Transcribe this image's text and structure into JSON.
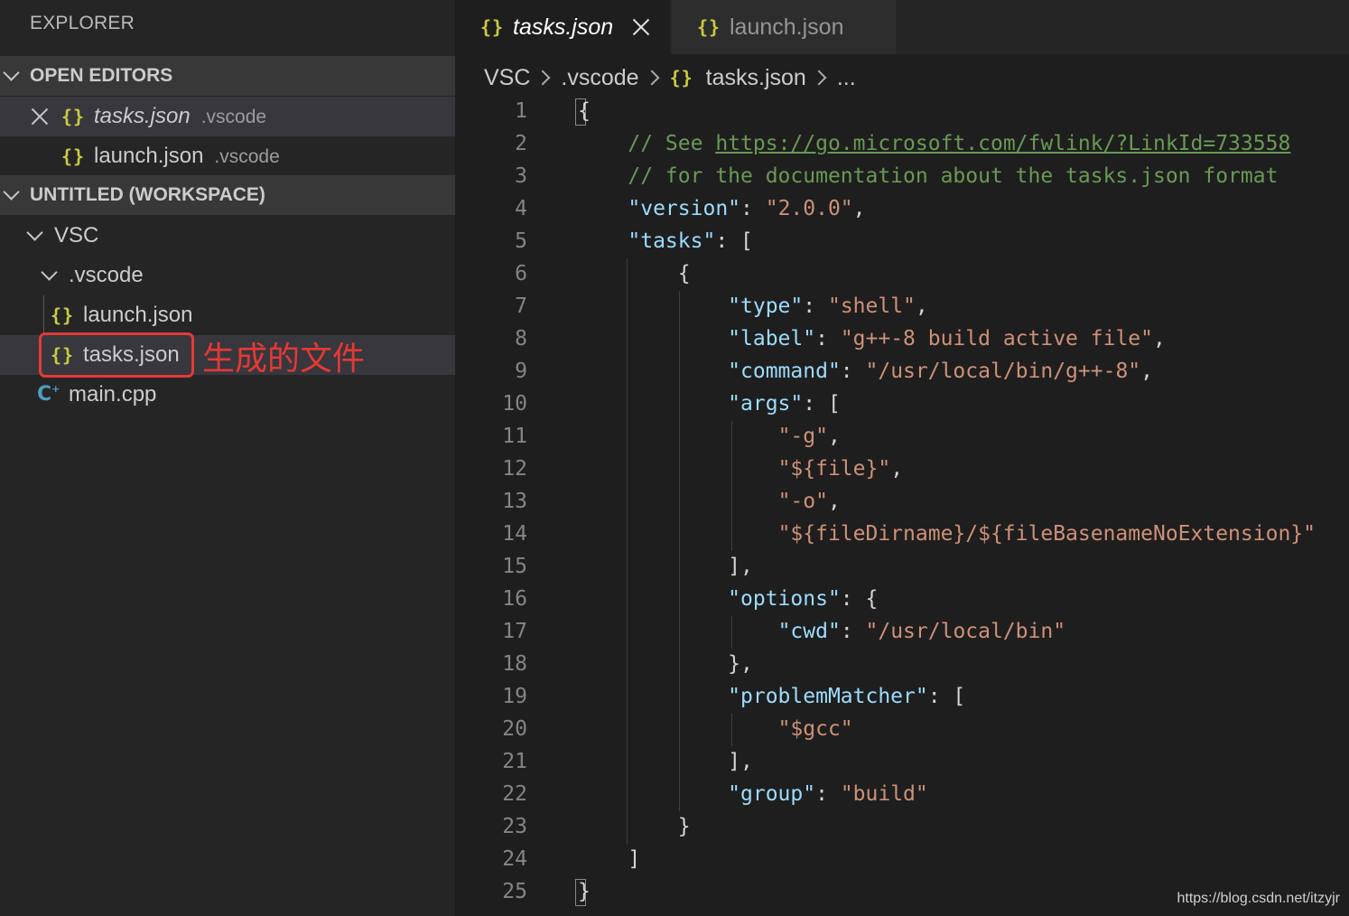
{
  "sidebar": {
    "title": "EXPLORER",
    "open_editors": {
      "header": "OPEN EDITORS",
      "items": [
        {
          "icon": "json-braces-icon",
          "name": "tasks.json",
          "folder": ".vscode"
        },
        {
          "icon": "json-braces-icon",
          "name": "launch.json",
          "folder": ".vscode"
        }
      ]
    },
    "workspace": {
      "header": "UNTITLED (WORKSPACE)",
      "root": "VSC",
      "subfolder": ".vscode",
      "files": [
        "launch.json",
        "tasks.json"
      ],
      "root_file": "main.cpp"
    },
    "annotation": "生成的文件"
  },
  "tabs": [
    {
      "label": "tasks.json",
      "active": true
    },
    {
      "label": "launch.json",
      "active": false
    }
  ],
  "breadcrumb": [
    "VSC",
    ".vscode",
    "tasks.json",
    "..."
  ],
  "line_numbers": [
    "1",
    "2",
    "3",
    "4",
    "5",
    "6",
    "7",
    "8",
    "9",
    "10",
    "11",
    "12",
    "13",
    "14",
    "15",
    "16",
    "17",
    "18",
    "19",
    "20",
    "21",
    "22",
    "23",
    "24",
    "25"
  ],
  "code": {
    "comment_prefix": "// See ",
    "link": "https://go.microsoft.com/fwlink/?LinkId=733558",
    "comment2": "// for the documentation about the tasks.json format",
    "version_key": "\"version\"",
    "version_val": "\"2.0.0\"",
    "tasks_key": "\"tasks\"",
    "type_key": "\"type\"",
    "type_val": "\"shell\"",
    "label_key": "\"label\"",
    "label_val": "\"g++-8 build active file\"",
    "command_key": "\"command\"",
    "command_val": "\"/usr/local/bin/g++-8\"",
    "args_key": "\"args\"",
    "arg1": "\"-g\"",
    "arg2": "\"${file}\"",
    "arg3": "\"-o\"",
    "arg4": "\"${fileDirname}/${fileBasenameNoExtension}\"",
    "options_key": "\"options\"",
    "cwd_key": "\"cwd\"",
    "cwd_val": "\"/usr/local/bin\"",
    "pm_key": "\"problemMatcher\"",
    "pm_val": "\"$gcc\"",
    "group_key": "\"group\"",
    "group_val": "\"build\""
  },
  "watermark": "https://blog.csdn.net/itzyjr",
  "colors": {
    "accent_json": "#cbcb41",
    "annotation_red": "#e53935",
    "cpp_icon": "#519aba"
  }
}
